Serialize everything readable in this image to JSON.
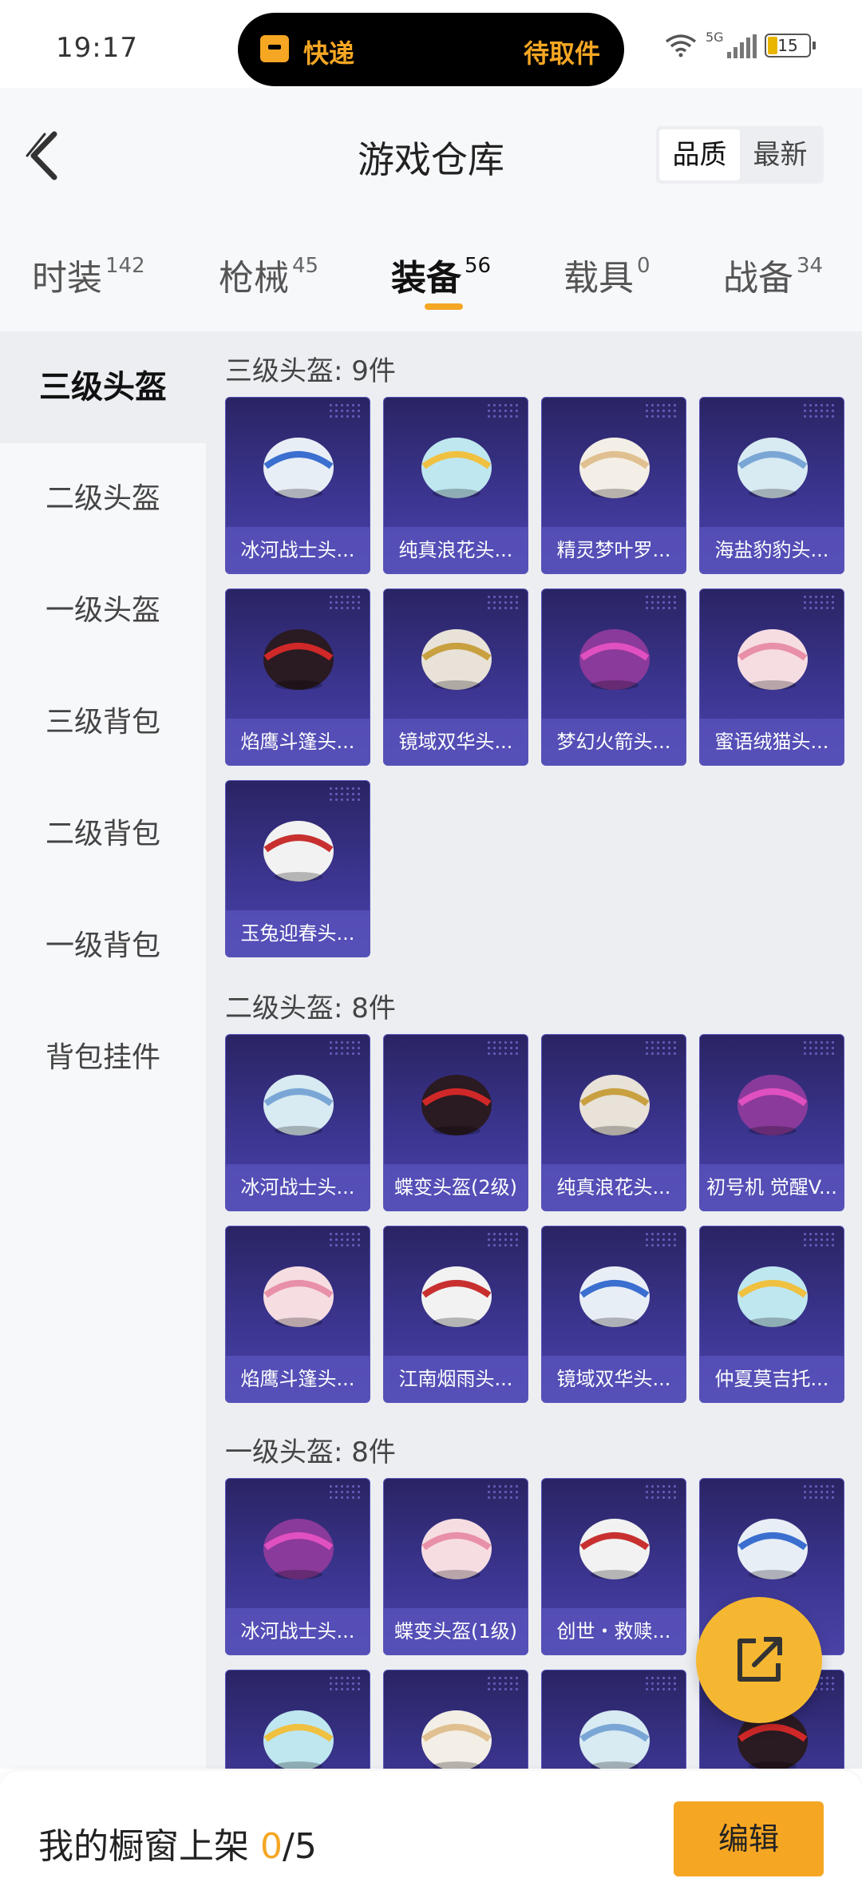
{
  "status_bar": {
    "time": "19:17",
    "island_left": "快递",
    "island_right": "待取件",
    "network": "5G",
    "battery": "15"
  },
  "header": {
    "title": "游戏仓库",
    "sort_quality": "品质",
    "sort_latest": "最新"
  },
  "tabs": [
    {
      "label": "时装",
      "count": "142"
    },
    {
      "label": "枪械",
      "count": "45"
    },
    {
      "label": "装备",
      "count": "56"
    },
    {
      "label": "载具",
      "count": "0"
    },
    {
      "label": "战备",
      "count": "34"
    }
  ],
  "sidebar": {
    "items": [
      {
        "label": "三级头盔"
      },
      {
        "label": "二级头盔"
      },
      {
        "label": "一级头盔"
      },
      {
        "label": "三级背包"
      },
      {
        "label": "二级背包"
      },
      {
        "label": "一级背包"
      },
      {
        "label": "背包挂件"
      }
    ]
  },
  "sections": [
    {
      "title": "三级头盔: 9件",
      "items": [
        "冰河战士头...",
        "纯真浪花头...",
        "精灵梦叶罗...",
        "海盐豹豹头...",
        "焰鹰斗篷头...",
        "镜域双华头...",
        "梦幻火箭头...",
        "蜜语绒猫头...",
        "玉兔迎春头..."
      ]
    },
    {
      "title": "二级头盔: 8件",
      "items": [
        "冰河战士头...",
        "蝶变头盔(2级)",
        "纯真浪花头...",
        "初号机 觉醒V...",
        "焰鹰斗篷头...",
        "江南烟雨头...",
        "镜域双华头...",
        "仲夏莫吉托..."
      ]
    },
    {
      "title": "一级头盔: 8件",
      "items": [
        "冰河战士头...",
        "蝶变头盔(1级)",
        "创世・救赎...",
        "",
        "",
        "",
        "",
        ""
      ]
    }
  ],
  "bottom_bar": {
    "label": "我的橱窗上架 ",
    "count": "0",
    "total": "/5",
    "edit": "编辑"
  },
  "colors": {
    "accent": "#f5a623",
    "card_bg": "#3b3590"
  }
}
